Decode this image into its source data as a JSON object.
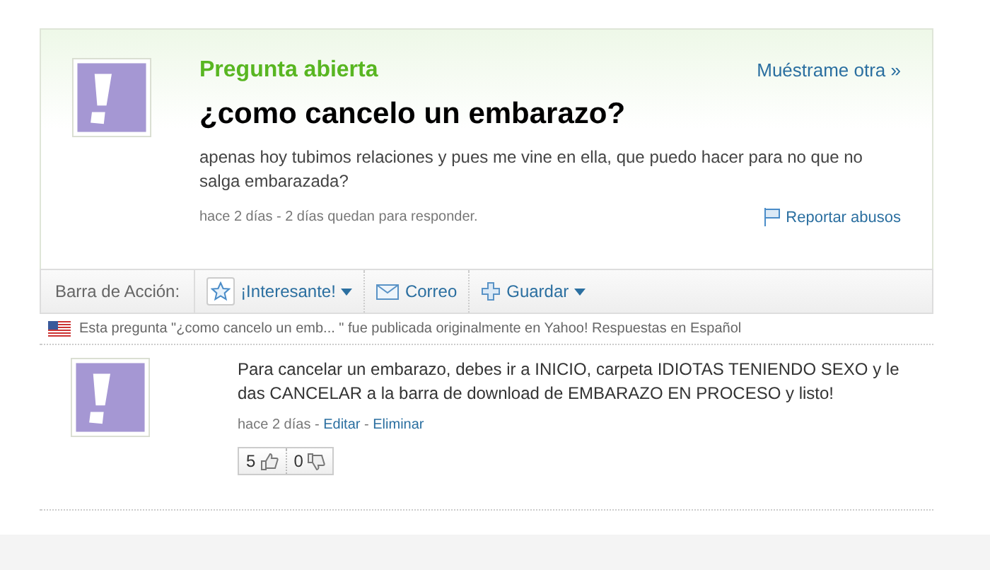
{
  "question": {
    "status": "Pregunta abierta",
    "show_another": "Muéstrame otra »",
    "title": "¿como cancelo un embarazo?",
    "body": "apenas hoy tubimos relaciones y pues me vine en ella, que puedo hacer para no que no salga embarazada?",
    "meta": "hace 2 días - 2 días quedan para responder.",
    "report": "Reportar abusos"
  },
  "action_bar": {
    "label": "Barra de Acción:",
    "actions": [
      {
        "kind": "star",
        "label": "¡Interesante!",
        "dropdown": true
      },
      {
        "kind": "mail",
        "label": "Correo",
        "dropdown": false
      },
      {
        "kind": "plus",
        "label": "Guardar",
        "dropdown": true
      }
    ]
  },
  "notice": {
    "text": "Esta pregunta \"¿como cancelo un emb... \" fue publicada originalmente en",
    "link": "Yahoo! Respuestas en Español"
  },
  "answers": [
    {
      "text": "Para cancelar un embarazo, debes ir a INICIO, carpeta IDIOTAS TENIENDO SEXO y le das CANCELAR a la barra de download de EMBARAZO EN PROCESO y listo!",
      "meta_parts": [
        {
          "kind": "text",
          "text": "hace 2 días -"
        },
        {
          "kind": "link",
          "text": "Editar"
        },
        {
          "kind": "text",
          "text": "-"
        },
        {
          "kind": "link",
          "text": "Eliminar"
        }
      ],
      "thumbs_up": "5",
      "thumbs_down": "0"
    }
  ]
}
